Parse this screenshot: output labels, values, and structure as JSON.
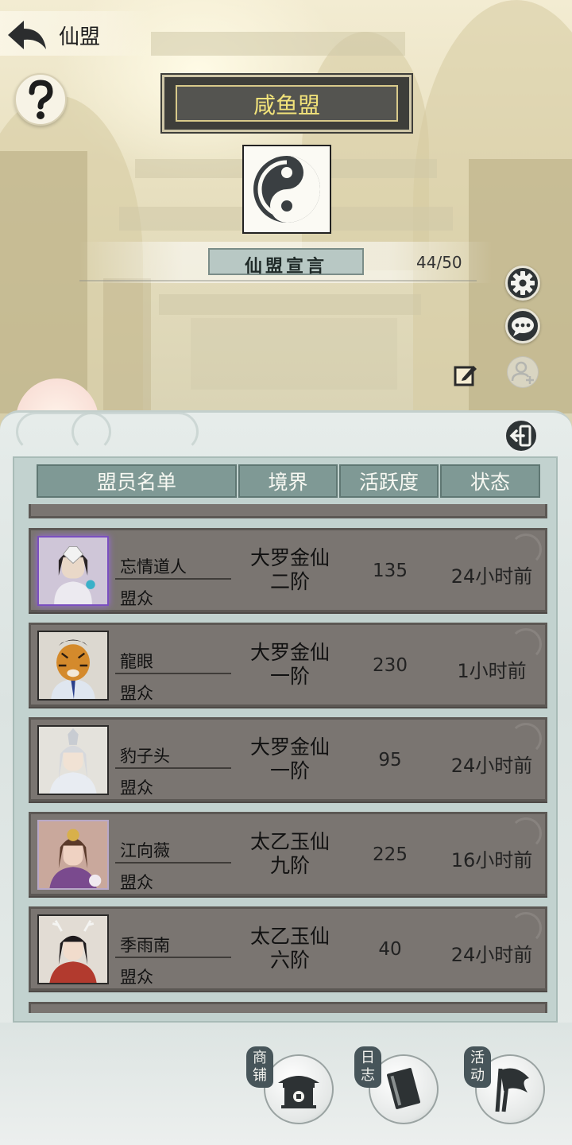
{
  "header": {
    "title": "仙盟"
  },
  "guild": {
    "name": "咸鱼盟",
    "declaration_label": "仙盟宣言",
    "member_count": "44/50"
  },
  "table": {
    "headers": [
      "盟员名单",
      "境界",
      "活跃度",
      "状态"
    ]
  },
  "members": [
    {
      "name": "忘情道人",
      "role": "盟众",
      "realm_line1": "大罗金仙",
      "realm_line2": "二阶",
      "activity": "135",
      "status": "24小时前"
    },
    {
      "name": "龍眼",
      "role": "盟众",
      "realm_line1": "大罗金仙",
      "realm_line2": "一阶",
      "activity": "230",
      "status": "1小时前"
    },
    {
      "name": "豹子头",
      "role": "盟众",
      "realm_line1": "大罗金仙",
      "realm_line2": "一阶",
      "activity": "95",
      "status": "24小时前"
    },
    {
      "name": "江向薇",
      "role": "盟众",
      "realm_line1": "太乙玉仙",
      "realm_line2": "九阶",
      "activity": "225",
      "status": "16小时前"
    },
    {
      "name": "季雨南",
      "role": "盟众",
      "realm_line1": "太乙玉仙",
      "realm_line2": "六阶",
      "activity": "40",
      "status": "24小时前"
    }
  ],
  "bottom_nav": {
    "shop": "商铺",
    "log": "日志",
    "events": "活动"
  },
  "icons": {
    "back": "back-arrow-icon",
    "help": "question-mark-icon",
    "emblem": "yin-yang-icon",
    "settings": "gear-icon",
    "chat": "chat-bubble-icon",
    "edit": "edit-icon",
    "add_friend": "add-friend-icon",
    "exit": "exit-door-icon"
  },
  "colors": {
    "guild_name": "#f2e37a",
    "header_cell": "#7f9995",
    "row_bg": "#7a7571"
  }
}
